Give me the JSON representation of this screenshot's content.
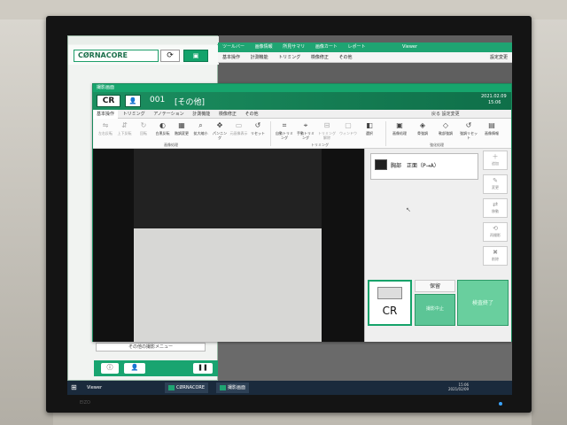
{
  "back_app": {
    "logo": "CØRNACORE",
    "menu": [
      "ツールバー",
      "画像情報",
      "所見サマリ",
      "画像カート",
      "レポート"
    ],
    "toolbar": [
      "基本操作",
      "計測機能",
      "トリミング",
      "検像修正",
      "その他"
    ],
    "viewer_label": "Viewer",
    "right_label": "設定変更",
    "sidebar_bottom_item": "その他の撮影メニュー"
  },
  "capture_window": {
    "title": "撮影画面",
    "badge": "CR",
    "study_number": "001",
    "study_type": "[その他]",
    "date": "2021.02.09",
    "time": "15:06",
    "tabs": [
      "基本操作",
      "トリミング",
      "アノテーション",
      "計測機能",
      "検像修正",
      "その他"
    ],
    "tab_right": "戻る  設定変更",
    "ribbon": {
      "group1": {
        "label": "画像処理",
        "buttons": [
          {
            "label": "左右反転",
            "icon": "flip-h-icon",
            "dim": true
          },
          {
            "label": "上下反転",
            "icon": "flip-v-icon",
            "dim": true
          },
          {
            "label": "回転",
            "icon": "rotate-icon",
            "dim": true
          },
          {
            "label": "白黒反転",
            "icon": "invert-icon",
            "dim": false
          },
          {
            "label": "階調変更",
            "icon": "contrast-icon",
            "dim": false
          },
          {
            "label": "拡大縮小",
            "icon": "zoom-icon",
            "dim": false
          },
          {
            "label": "パンニング",
            "icon": "pan-icon",
            "dim": false
          },
          {
            "label": "元画像表示",
            "icon": "original-icon",
            "dim": true
          },
          {
            "label": "リセット",
            "icon": "reset-icon",
            "dim": false
          }
        ]
      },
      "group2": {
        "label": "トリミング",
        "buttons": [
          {
            "label": "自動トリミング",
            "icon": "auto-trim-icon",
            "dim": false
          },
          {
            "label": "手動トリミング",
            "icon": "manual-trim-icon",
            "dim": false
          },
          {
            "label": "トリミング解除",
            "icon": "trim-cancel-icon",
            "dim": true
          },
          {
            "label": "ウィンドウ",
            "icon": "window-icon",
            "dim": true
          },
          {
            "label": "選択",
            "icon": "select-icon",
            "dim": false
          }
        ]
      },
      "group3": {
        "label": "強化処理",
        "buttons": [
          {
            "label": "画像処理",
            "icon": "process-icon",
            "dim": false
          },
          {
            "label": "骨強調",
            "icon": "bone-icon",
            "dim": false
          },
          {
            "label": "軟部強調",
            "icon": "soft-icon",
            "dim": false
          },
          {
            "label": "強調リセット",
            "icon": "enh-reset-icon",
            "dim": false
          },
          {
            "label": "画像情報",
            "icon": "info-icon",
            "dim": false
          }
        ]
      }
    },
    "series_label": "胸部　正面（P→A）",
    "side_buttons": [
      {
        "label": "追加",
        "icon": "add-icon"
      },
      {
        "label": "変更",
        "icon": "change-icon"
      },
      {
        "label": "移動",
        "icon": "move-icon"
      },
      {
        "label": "再撮影",
        "icon": "retake-icon"
      },
      {
        "label": "削除",
        "icon": "delete-icon"
      }
    ],
    "cr_button_label": "CR",
    "hold_label": "保留",
    "cancel_exposure_label": "撮影中止",
    "end_study_label": "検査終了"
  },
  "taskbar": {
    "items": [
      "Viewer",
      "CØRNACORE",
      "撮影画面"
    ],
    "clock_time": "15:06",
    "clock_date": "2021/02/09"
  },
  "monitor": {
    "brand": "EIZO"
  },
  "colors": {
    "accent_green": "#17a56d",
    "header_dark_green": "#0f6f49",
    "taskbar": "#1a2a3c"
  }
}
